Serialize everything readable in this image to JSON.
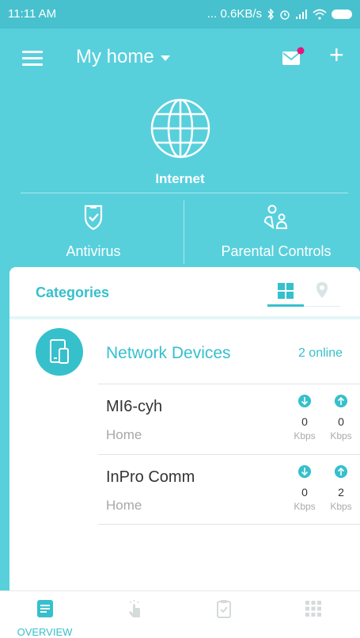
{
  "status_bar": {
    "time": "11:11 AM",
    "network_speed": "... 0.6KB/s"
  },
  "header": {
    "title": "My home"
  },
  "internet": {
    "label": "Internet"
  },
  "features": [
    {
      "label": "Antivirus",
      "icon": "shield-check-icon"
    },
    {
      "label": "Parental Controls",
      "icon": "family-icon"
    }
  ],
  "categories": {
    "title": "Categories",
    "category": {
      "name": "Network Devices",
      "status": "2 online",
      "icon": "devices-icon"
    },
    "devices": [
      {
        "name": "MI6-cyh",
        "group": "Home",
        "download": "0",
        "upload": "0",
        "download_unit": "Kbps",
        "upload_unit": "Kbps"
      },
      {
        "name": "InPro Comm",
        "group": "Home",
        "download": "0",
        "upload": "2",
        "download_unit": "Kbps",
        "upload_unit": "Kbps"
      }
    ]
  },
  "bottom_nav": {
    "active_label": "OVERVIEW",
    "items": [
      "overview-icon",
      "tap-icon",
      "report-icon",
      "apps-grid-icon"
    ]
  },
  "colors": {
    "background": "#57d0dc",
    "accent": "#36c0cc",
    "notification_dot": "#e5177f"
  }
}
